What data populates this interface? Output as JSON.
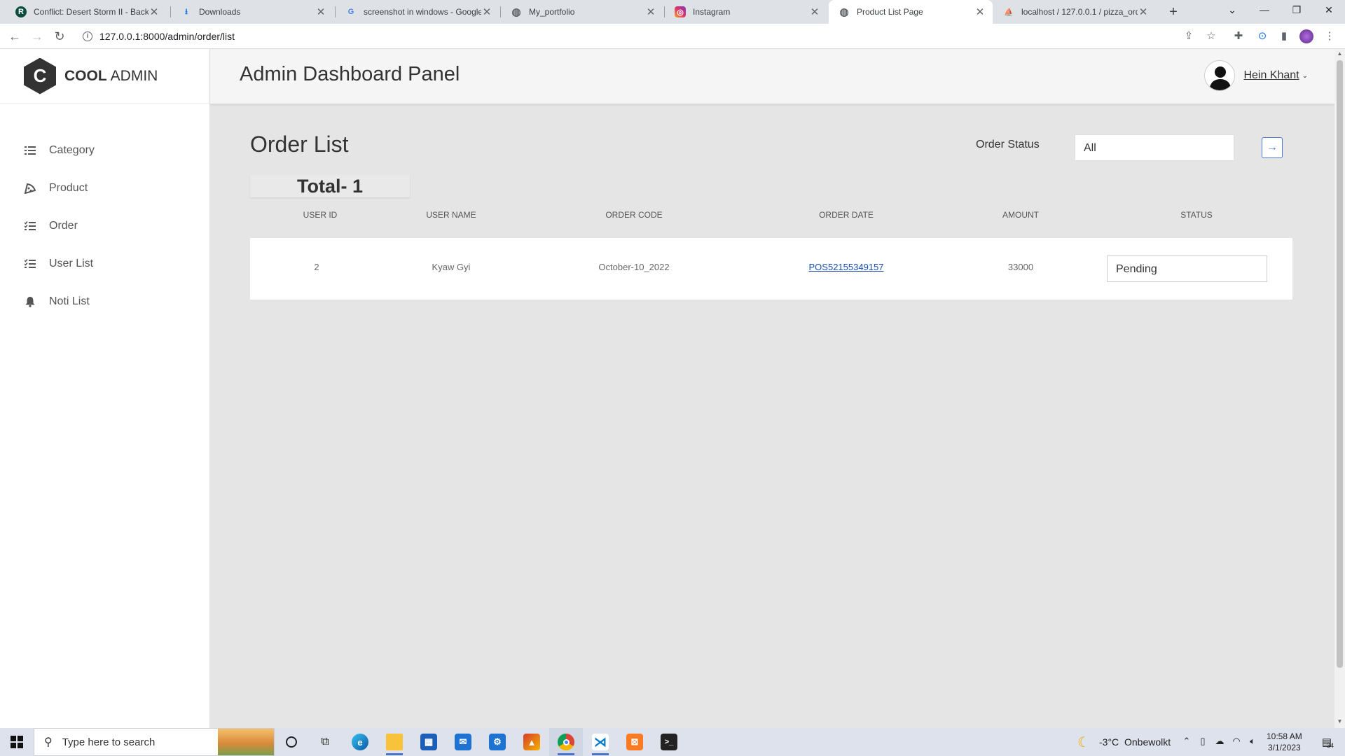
{
  "browser": {
    "tabs": [
      {
        "title": "Conflict: Desert Storm II - Back t",
        "favicon": "R"
      },
      {
        "title": "Downloads",
        "favicon": "⭳"
      },
      {
        "title": "screenshot in windows - Google",
        "favicon": "G"
      },
      {
        "title": "My_portfolio",
        "favicon": "◍"
      },
      {
        "title": "Instagram",
        "favicon": "◎"
      },
      {
        "title": "Product List Page",
        "favicon": "◍"
      },
      {
        "title": "localhost / 127.0.0.1 / pizza_ord",
        "favicon": "⛵"
      }
    ],
    "active_tab_index": 5,
    "url": "127.0.0.1:8000/admin/order/list"
  },
  "sidebar": {
    "brand_bold": "COOL",
    "brand_light": "ADMIN",
    "logo_letter": "C",
    "items": [
      {
        "label": "Category",
        "icon": "list-icon"
      },
      {
        "label": "Product",
        "icon": "pizza-icon"
      },
      {
        "label": "Order",
        "icon": "checklist-icon"
      },
      {
        "label": "User List",
        "icon": "checklist-icon"
      },
      {
        "label": "Noti List",
        "icon": "bell-icon"
      }
    ]
  },
  "header": {
    "title": "Admin Dashboard Panel",
    "user_name": "Hein Khant"
  },
  "main": {
    "title": "Order List",
    "status_label": "Order Status",
    "status_filter_value": "All",
    "total_text": "Total- 1",
    "columns": [
      "USER ID",
      "USER NAME",
      "ORDER CODE",
      "ORDER DATE",
      "AMOUNT",
      "STATUS"
    ],
    "rows": [
      {
        "user_id": "2",
        "user_name": "Kyaw Gyi",
        "order_code": "October-10_2022",
        "order_date": "POS52155349157",
        "amount": "33000",
        "status": "Pending"
      }
    ]
  },
  "taskbar": {
    "search_placeholder": "Type here to search",
    "weather_temp": "-3°C",
    "weather_desc": "Onbewolkt",
    "time": "10:58 AM",
    "date": "3/1/2023",
    "notification_count": "34"
  },
  "colors": {
    "accent": "#4a7bd0",
    "link": "#1a4bb5",
    "sidebar_bg": "#ffffff",
    "content_bg": "#e5e5e5"
  }
}
